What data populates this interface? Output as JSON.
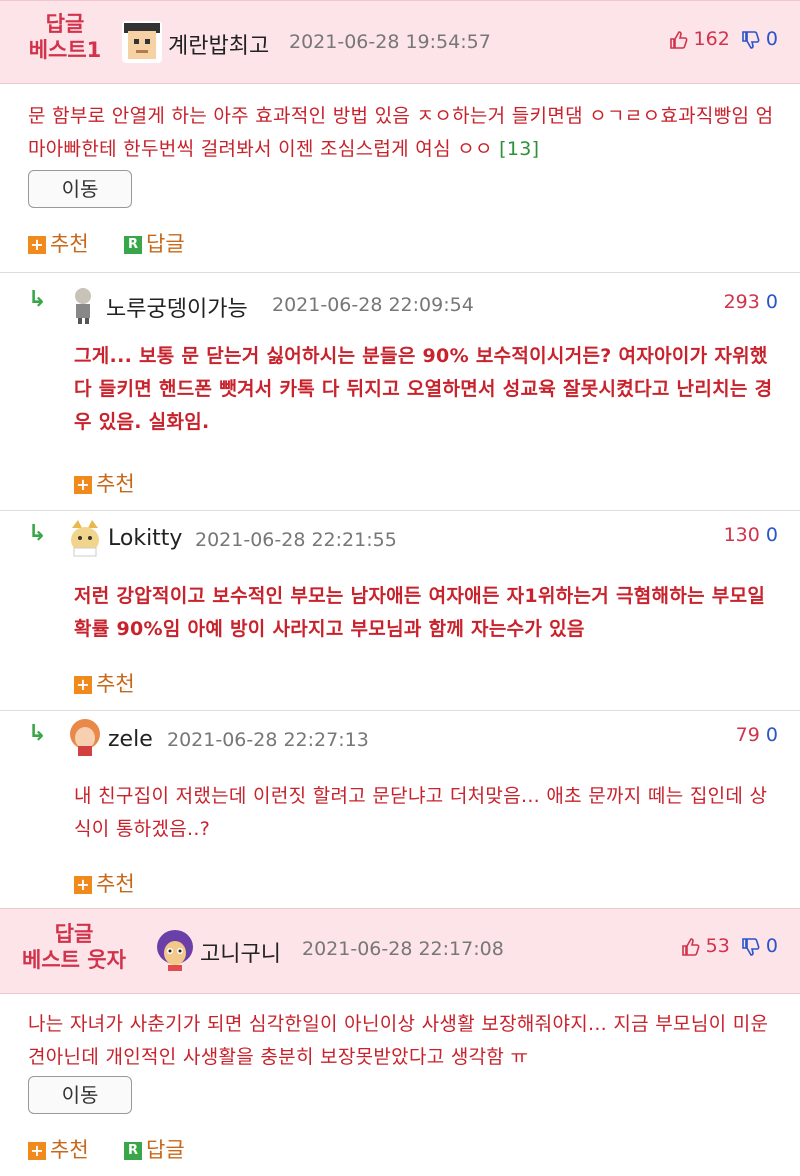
{
  "best1": {
    "label_line1": "답글",
    "label_line2": "베스트1",
    "nick": "계란밥최고",
    "date": "2021-06-28 19:54:57",
    "up": "162",
    "down": "0",
    "text": "문 함부로 안열게 하는 아주 효과적인 방법 있음 ㅈㅇ하는거 들키면댐 ㅇㄱㄹㅇ효과직빵임 엄마아빠한테 한두번씩 걸려봐서 이젠 조심스럽게 여심 ㅇㅇ",
    "ref": "[13]",
    "move": "이동",
    "recommend": "추천",
    "reply": "답글"
  },
  "replies": [
    {
      "nick": "노루궁뎅이가능",
      "date": "2021-06-28 22:09:54",
      "up": "293",
      "down": "0",
      "text": "그게... 보통 문 닫는거 싫어하시는 분들은 90% 보수적이시거든? 여자아이가 자위했다 들키면 핸드폰 뺏겨서 카톡 다 뒤지고 오열하면서 성교육 잘못시켰다고 난리치는 경우 있음. 실화임.",
      "recommend": "추천"
    },
    {
      "nick": "Lokitty",
      "date": "2021-06-28 22:21:55",
      "up": "130",
      "down": "0",
      "text": "저런 강압적이고 보수적인 부모는 남자애든 여자애든 자1위하는거 극혐해하는 부모일 확률 90%임 아예 방이 사라지고 부모님과 함께 자는수가 있음",
      "recommend": "추천"
    },
    {
      "nick": "zele",
      "date": "2021-06-28 22:27:13",
      "up": "79",
      "down": "0",
      "text": "내 친구집이 저랬는데 이런짓 할려고 문닫냐고 더처맞음... 애초 문까지 떼는 집인데 상식이 통하겠음..?",
      "recommend": "추천"
    }
  ],
  "best_funny": {
    "label_line1": "답글",
    "label_line2": "베스트 웃자",
    "nick": "고니구니",
    "date": "2021-06-28 22:17:08",
    "up": "53",
    "down": "0",
    "text": "나는 자녀가 사춘기가 되면 심각한일이 아닌이상 사생활 보장해줘야지... 지금 부모님이 미운견아닌데 개인적인 사생활을 충분히 보장못받았다고 생각함 ㅠ",
    "move": "이동",
    "recommend": "추천",
    "reply": "답글"
  }
}
